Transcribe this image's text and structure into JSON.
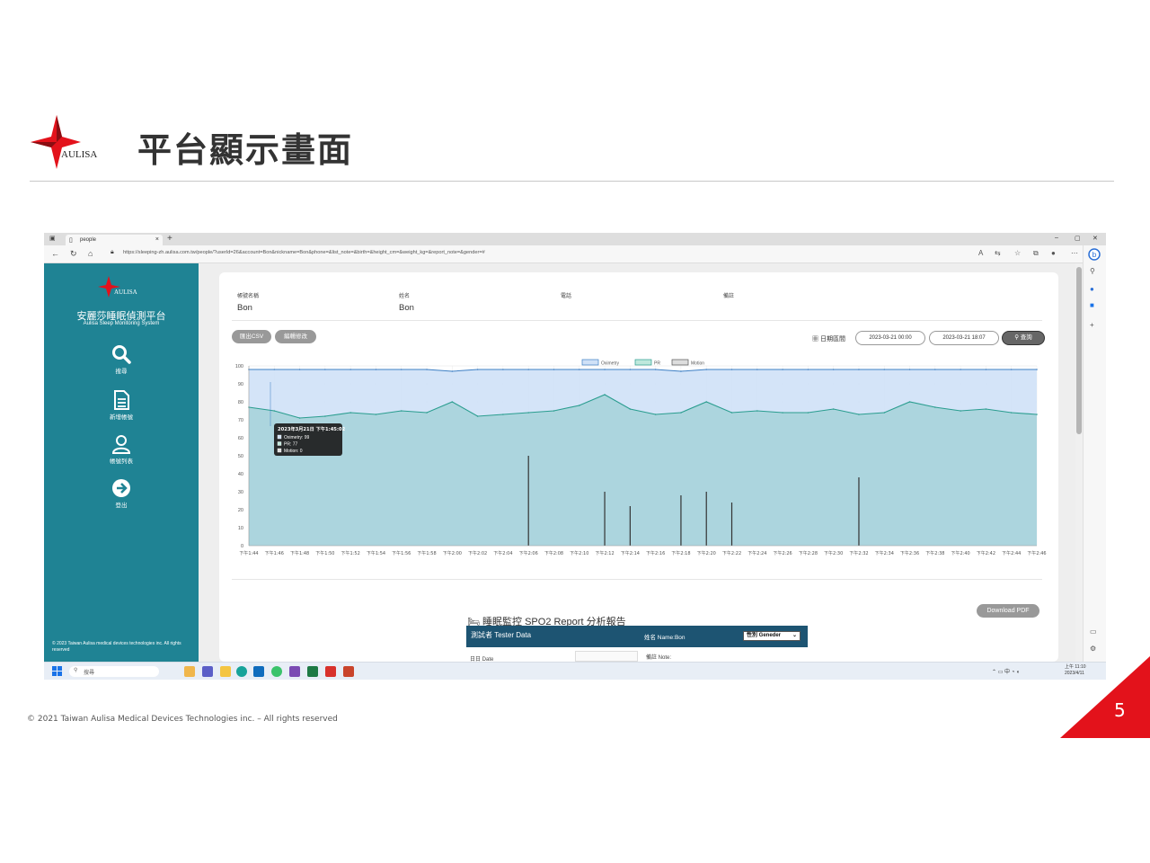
{
  "slide": {
    "title": "平台顯示畫面",
    "logo_text": "AULISA",
    "copyright": "© 2021 Taiwan Aulisa Medical Devices Technologies inc. – All rights reserved",
    "page_number": "5",
    "colors": {
      "brand_red": "#e3121b",
      "teal": "#1f8394",
      "navy": "#1d5472"
    }
  },
  "browser": {
    "tab_title": "people",
    "url": "https://sleeping-zh.aulisa.com.tw/people/?userId=26&account=Bon&nickname=Bon&phone=&list_note=&birth=&height_cm=&weight_kg=&report_note=&gender=#"
  },
  "sidebar": {
    "logo_text": "AULISA",
    "title": "安麗莎睡眠偵測平台",
    "subtitle": "Aulisa Sleep Monitoring System",
    "items": [
      {
        "label": "搜尋",
        "icon": "search-icon"
      },
      {
        "label": "新增帳號",
        "icon": "document-icon"
      },
      {
        "label": "帳號列表",
        "icon": "user-icon"
      },
      {
        "label": "登出",
        "icon": "arrow-right-circle-icon"
      }
    ],
    "footer": "© 2023 Taiwan Aulisa medical devices technologies inc. All rights reserved"
  },
  "profile": {
    "account_label": "帳號名稱",
    "account_value": "Bon",
    "name_label": "姓名",
    "name_value": "Bon",
    "phone_label": "電話",
    "note_label": "備註"
  },
  "toolbar": {
    "export_csv": "匯出CSV",
    "edit": "編輯修改",
    "date_range_label": "日期區間",
    "start_date": "2023-03-21 00:00",
    "end_date": "2023-03-21 18:07",
    "query": "查詢"
  },
  "chart_data": {
    "type": "area",
    "legend": [
      "Oximetry",
      "PR",
      "Motion"
    ],
    "y_ticks": [
      0,
      10,
      20,
      30,
      40,
      50,
      60,
      70,
      80,
      90,
      100
    ],
    "ylim": [
      0,
      100
    ],
    "x_ticks": [
      "下午1:44",
      "下午1:46",
      "下午1:48",
      "下午1:50",
      "下午1:52",
      "下午1:54",
      "下午1:56",
      "下午1:58",
      "下午2:00",
      "下午2:02",
      "下午2:04",
      "下午2:06",
      "下午2:08",
      "下午2:10",
      "下午2:12",
      "下午2:14",
      "下午2:16",
      "下午2:18",
      "下午2:20",
      "下午2:22",
      "下午2:24",
      "下午2:26",
      "下午2:28",
      "下午2:30",
      "下午2:32",
      "下午2:34",
      "下午2:36",
      "下午2:38",
      "下午2:40",
      "下午2:42",
      "下午2:44",
      "下午2:46"
    ],
    "series": [
      {
        "name": "Oximetry",
        "color": "#3d7fc4",
        "values": [
          98,
          98,
          98,
          98,
          98,
          98,
          98,
          98,
          97,
          98,
          98,
          98,
          98,
          98,
          98,
          98,
          98,
          97,
          98,
          98,
          98,
          98,
          98,
          98,
          98,
          98,
          98,
          98,
          98,
          98,
          98,
          98
        ]
      },
      {
        "name": "PR",
        "color": "#2a9d8f",
        "values": [
          77,
          75,
          71,
          72,
          74,
          73,
          75,
          74,
          80,
          72,
          73,
          74,
          75,
          78,
          84,
          76,
          73,
          74,
          80,
          74,
          75,
          74,
          74,
          76,
          73,
          74,
          80,
          77,
          75,
          76,
          74,
          73
        ]
      },
      {
        "name": "Motion",
        "color": "#333333",
        "values": [
          0,
          0,
          0,
          0,
          0,
          0,
          0,
          0,
          0,
          0,
          0,
          50,
          0,
          0,
          30,
          22,
          0,
          28,
          30,
          24,
          0,
          0,
          0,
          0,
          38,
          0,
          0,
          0,
          0,
          0,
          0,
          0
        ]
      }
    ],
    "tooltip": {
      "title": "2023年3月21日 下午1:45:02",
      "lines": [
        "Oximetry: 99",
        "PR: 77",
        "Motion: 0"
      ]
    }
  },
  "report": {
    "download_pdf": "Download PDF",
    "title": "睡眠監控 SPO2 Report 分析報告",
    "tester_label": "測試者 Tester Data",
    "name_label": "姓名 Name:Bon",
    "gender_select": "性別 Geneder",
    "date_label": "日日 Date",
    "note_label": "備註 Note:"
  },
  "taskbar": {
    "search_placeholder": "搜尋",
    "tray": "中",
    "time": "上午 11:10",
    "date": "2023/4/11"
  }
}
